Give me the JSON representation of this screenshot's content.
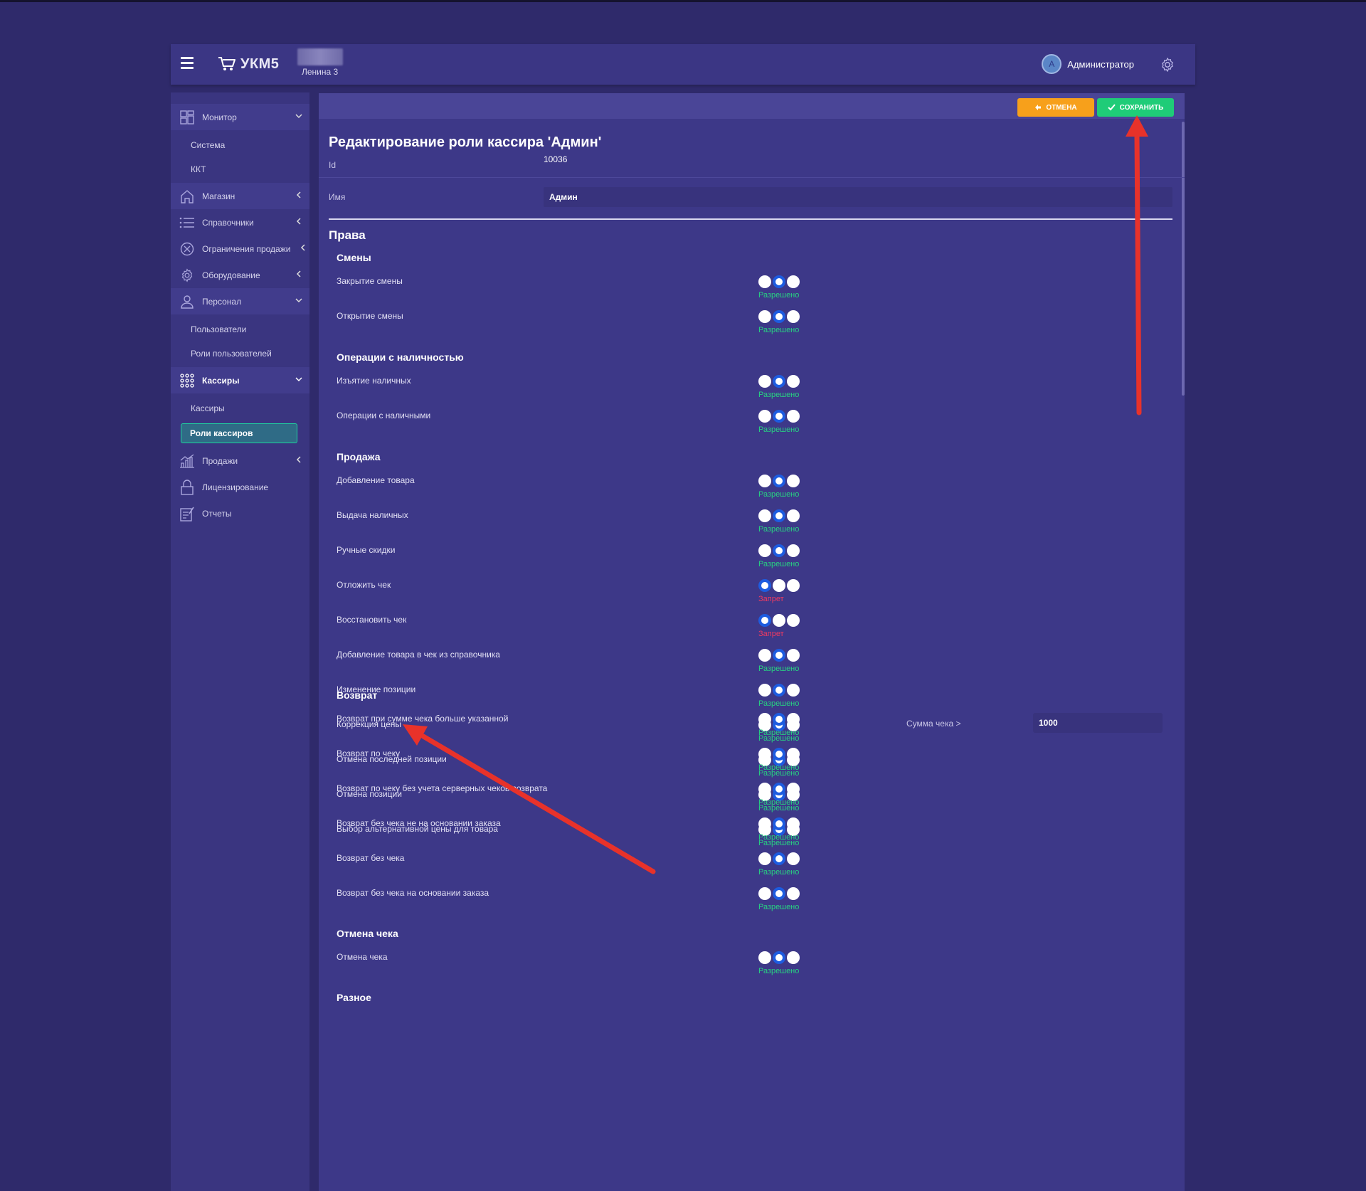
{
  "header": {
    "logo": "УКМ5",
    "store": "Ленина 3",
    "avatar_letter": "А",
    "user": "Администратор"
  },
  "sidebar": {
    "monitor": "Монитор",
    "monitor_items": [
      "Система",
      "ККТ"
    ],
    "shop": "Магазин",
    "refs": "Справочники",
    "limits": "Ограничения продажи",
    "equipment": "Оборудование",
    "staff": "Персонал",
    "staff_items": [
      "Пользователи",
      "Роли пользователей"
    ],
    "cashiers": "Кассиры",
    "cashiers_items": [
      "Кассиры",
      "Роли кассиров"
    ],
    "sales": "Продажи",
    "licensing": "Лицензирование",
    "reports": "Отчеты"
  },
  "toolbar": {
    "cancel": "ОТМЕНА",
    "save": "СОХРАНИТЬ"
  },
  "form": {
    "title": "Редактирование роли кассира 'Админ'",
    "id_label": "Id",
    "id_value": "10036",
    "name_label": "Имя",
    "name_value": "Админ",
    "rights": "Права"
  },
  "sections": [
    {
      "title": "Смены",
      "items": [
        {
          "label": "Закрытие смены",
          "selected": 1,
          "status": "Разрешено"
        },
        {
          "label": "Открытие смены",
          "selected": 1,
          "status": "Разрешено"
        }
      ]
    },
    {
      "title": "Операции с наличностью",
      "items": [
        {
          "label": "Изъятие наличных",
          "selected": 1,
          "status": "Разрешено"
        },
        {
          "label": "Операции с наличными",
          "selected": 1,
          "status": "Разрешено"
        }
      ]
    },
    {
      "title": "Продажа",
      "items": [
        {
          "label": "Добавление товара",
          "selected": 1,
          "status": "Разрешено"
        },
        {
          "label": "Выдача наличных",
          "selected": 1,
          "status": "Разрешено"
        },
        {
          "label": "Ручные скидки",
          "selected": 1,
          "status": "Разрешено"
        },
        {
          "label": "Отложить чек",
          "selected": 0,
          "status": "Запрет"
        },
        {
          "label": "Восстановить чек",
          "selected": 0,
          "status": "Запрет"
        },
        {
          "label": "Добавление товара в чек из справочника",
          "selected": 1,
          "status": "Разрешено"
        },
        {
          "label": "Изменение позиции",
          "selected": 1,
          "status": "Разрешено"
        },
        {
          "label": "Коррекция цены",
          "selected": 1,
          "status": "Разрешено"
        },
        {
          "label": "Отмена последней позиции",
          "selected": 1,
          "status": "Разрешено"
        },
        {
          "label": "Отмена позиции",
          "selected": 1,
          "status": "Разрешено"
        },
        {
          "label": "Выбор альтернативной цены для товара",
          "selected": 1,
          "status": "Разрешено"
        }
      ]
    },
    {
      "title": "Возврат",
      "items": [
        {
          "label": "Возврат при сумме чека больше указанной",
          "selected": 1,
          "status": "Разрешено",
          "extra_label": "Сумма чека >",
          "extra_value": "1000"
        },
        {
          "label": "Возврат по чеку",
          "selected": 1,
          "status": "Разрешено"
        },
        {
          "label": "Возврат по чеку без учета серверных чеков возврата",
          "selected": 1,
          "status": "Разрешено"
        },
        {
          "label": "Возврат без чека не на основании заказа",
          "selected": 1,
          "status": "Разрешено"
        },
        {
          "label": "Возврат без чека",
          "selected": 1,
          "status": "Разрешено"
        },
        {
          "label": "Возврат без чека на основании заказа",
          "selected": 1,
          "status": "Разрешено"
        }
      ]
    },
    {
      "title": "Отмена чека",
      "items": [
        {
          "label": "Отмена чека",
          "selected": 1,
          "status": "Разрешено"
        }
      ]
    },
    {
      "title": "Разное",
      "items": []
    }
  ],
  "colors": {
    "allowed": "#28d282",
    "denied": "#ee3a62",
    "radio_selected": "#1d5ce0",
    "annotation": "#e8322a"
  }
}
